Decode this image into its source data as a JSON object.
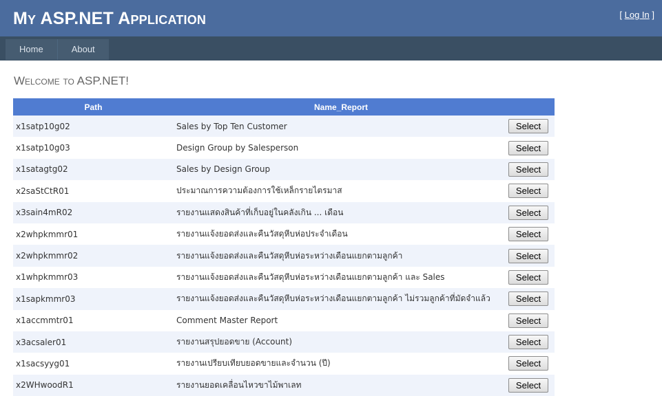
{
  "header": {
    "title": "My ASP.NET Application",
    "login": {
      "open": "[ ",
      "link": "Log In",
      "close": " ]"
    }
  },
  "menu": [
    {
      "label": "Home"
    },
    {
      "label": "About"
    }
  ],
  "main": {
    "heading": "Welcome to ASP.NET!",
    "grid": {
      "columns": [
        "Path",
        "Name_Report"
      ],
      "button_label": "Select",
      "rows": [
        {
          "path": "x1satp10g02",
          "name": "Sales by Top Ten Customer"
        },
        {
          "path": "x1satp10g03",
          "name": "Design Group by Salesperson"
        },
        {
          "path": "x1satagtg02",
          "name": "Sales by Design Group"
        },
        {
          "path": "x2saStCtR01",
          "name": "ประมาณการความต้องการใช้เหล็กรายไตรมาส"
        },
        {
          "path": "x3sain4mR02",
          "name": "รายงานแสดงสินค้าที่เก็บอยู่ในคลังเกิน ... เดือน"
        },
        {
          "path": "x2whpkmmr01",
          "name": "รายงานแจ้งยอดส่งและคืนวัสดุหีบห่อประจำเดือน"
        },
        {
          "path": "x2whpkmmr02",
          "name": "รายงานแจ้งยอดส่งและคืนวัสดุหีบห่อระหว่างเดือนแยกตามลูกค้า"
        },
        {
          "path": "x1whpkmmr03",
          "name": "รายงานแจ้งยอดส่งและคืนวัสดุหีบห่อระหว่างเดือนแยกตามลูกค้า และ Sales"
        },
        {
          "path": "x1sapkmmr03",
          "name": "รายงานแจ้งยอดส่งและคืนวัสดุหีบห่อระหว่างเดือนแยกตามลูกค้า ไม่รวมลูกค้าที่มัดจำแล้ว"
        },
        {
          "path": "x1accmmtr01",
          "name": "Comment Master Report"
        },
        {
          "path": "x3acsaler01",
          "name": "รายงานสรุปยอดขาย (Account)"
        },
        {
          "path": "x1sacsyyg01",
          "name": "รายงานเปรียบเทียบยอดขายและจำนวน (ปี)"
        },
        {
          "path": "x2WHwoodR1",
          "name": "รายงานยอดเคลื่อนไหวขาไม้พาเลท"
        }
      ]
    }
  },
  "colors": {
    "header_bg": "#4b6c9e",
    "menu_bar_bg": "#3a4f63",
    "grid_header_bg": "#507cd1",
    "grid_alt_row_bg": "#eff3fb"
  }
}
